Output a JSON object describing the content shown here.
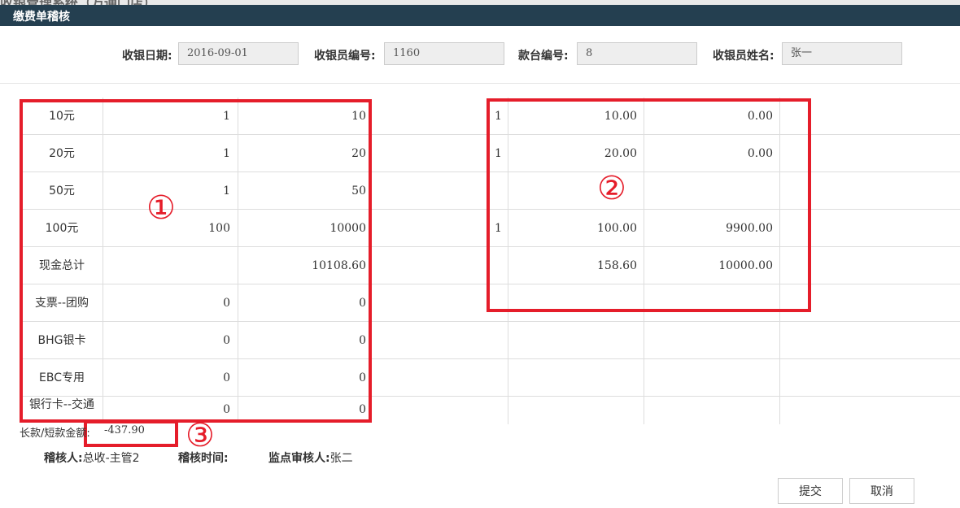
{
  "window": {
    "title": "缴费单稽核"
  },
  "header": {
    "date_label": "收银日期:",
    "date_value": "2016-09-01",
    "cashier_id_label": "收银员编号:",
    "cashier_id_value": "1160",
    "counter_label": "款台编号:",
    "counter_value": "8",
    "cashier_name_label": "收银员姓名:",
    "cashier_name_value": "张一"
  },
  "left_rows": [
    {
      "label": "10元",
      "count": "1",
      "amount": "10"
    },
    {
      "label": "20元",
      "count": "1",
      "amount": "20"
    },
    {
      "label": "50元",
      "count": "1",
      "amount": "50"
    },
    {
      "label": "100元",
      "count": "100",
      "amount": "10000"
    },
    {
      "label": "现金总计",
      "count": "",
      "amount": "10108.60"
    },
    {
      "label": "支票--团购",
      "count": "0",
      "amount": "0"
    },
    {
      "label": "BHG银卡",
      "count": "0",
      "amount": "0"
    },
    {
      "label": "EBC专用",
      "count": "0",
      "amount": "0"
    },
    {
      "label": "银行卡--交通",
      "count": "0",
      "amount": "0"
    }
  ],
  "right_rows": [
    {
      "n": "1",
      "v1": "10.00",
      "v2": "0.00"
    },
    {
      "n": "1",
      "v1": "20.00",
      "v2": "0.00"
    },
    {
      "n": "",
      "v1": "",
      "v2": ""
    },
    {
      "n": "1",
      "v1": "100.00",
      "v2": "9900.00"
    },
    {
      "n": "",
      "v1": "158.60",
      "v2": "10000.00"
    }
  ],
  "annotations": {
    "one": "①",
    "two": "②",
    "three": "③"
  },
  "balance": {
    "label": "长款/短款金额:",
    "value": "-437.90"
  },
  "footer": {
    "auditor_label": "稽核人:",
    "auditor_value": "总收-主管2",
    "audit_time_label": "稽核时间:",
    "audit_time_value": "",
    "reviewer_label": "监点审核人:",
    "reviewer_value": "张二"
  },
  "buttons": {
    "submit": "提交",
    "cancel": "取消"
  },
  "colors": {
    "titlebar": "#243f50",
    "annotation_red": "#e51d2a"
  }
}
